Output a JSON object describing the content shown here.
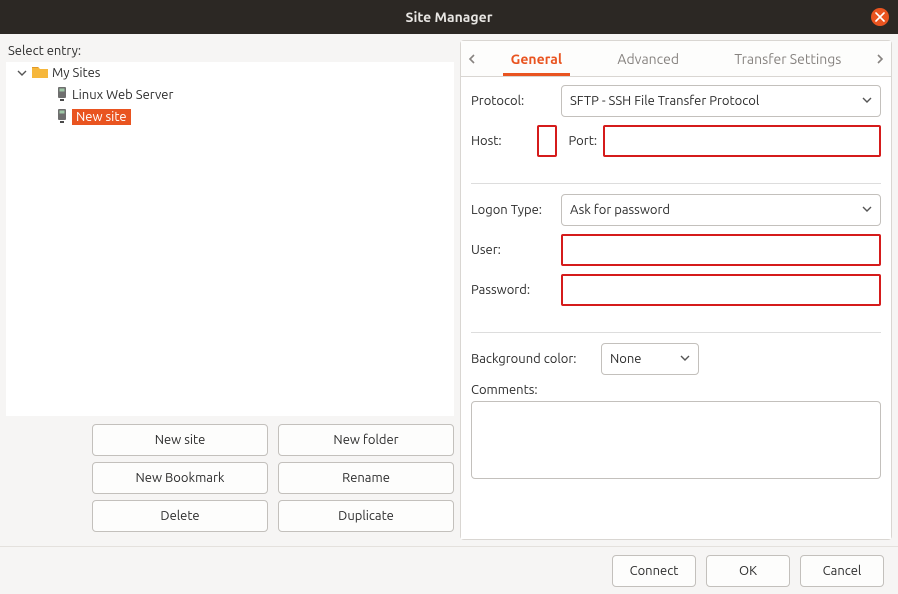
{
  "window": {
    "title": "Site Manager"
  },
  "left": {
    "select_label": "Select entry:",
    "tree": {
      "root_label": "My Sites",
      "items": [
        {
          "label": "Linux Web Server",
          "selected": false
        },
        {
          "label": "New site",
          "selected": true
        }
      ]
    },
    "buttons": {
      "new_site": "New site",
      "new_folder": "New folder",
      "new_bookmark": "New Bookmark",
      "rename": "Rename",
      "delete": "Delete",
      "duplicate": "Duplicate"
    }
  },
  "tabs": {
    "general": "General",
    "advanced": "Advanced",
    "transfer": "Transfer Settings"
  },
  "form": {
    "protocol_label": "Protocol:",
    "protocol_value": "SFTP - SSH File Transfer Protocol",
    "host_label": "Host:",
    "host_value": "",
    "port_label": "Port:",
    "port_value": "",
    "logon_label": "Logon Type:",
    "logon_value": "Ask for password",
    "user_label": "User:",
    "user_value": "",
    "password_label": "Password:",
    "password_value": "",
    "bgcolor_label": "Background color:",
    "bgcolor_value": "None",
    "comments_label": "Comments:",
    "comments_value": ""
  },
  "footer": {
    "connect": "Connect",
    "ok": "OK",
    "cancel": "Cancel"
  }
}
